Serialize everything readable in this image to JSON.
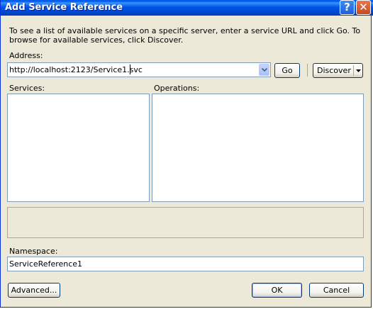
{
  "window": {
    "title": "Add Service Reference",
    "help_glyph": "?",
    "close_glyph": "✕"
  },
  "intro_text": "To see a list of available services on a specific server, enter a service URL and click Go. To browse for available services, click Discover.",
  "address": {
    "label": "Address:",
    "value": "http://localhost:2123/Service1.svc",
    "go_label": "Go",
    "discover_label": "Discover"
  },
  "services": {
    "label": "Services:",
    "items": []
  },
  "operations": {
    "label": "Operations:",
    "items": []
  },
  "namespace": {
    "label": "Namespace:",
    "value": "ServiceReference1"
  },
  "buttons": {
    "advanced": "Advanced...",
    "ok": "OK",
    "cancel": "Cancel"
  }
}
